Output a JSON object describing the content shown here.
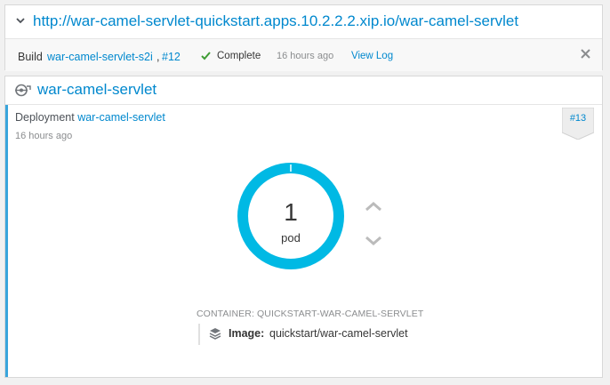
{
  "route": {
    "url": "http://war-camel-servlet-quickstart.apps.10.2.2.2.xip.io/war-camel-servlet"
  },
  "build": {
    "prefix": "Build",
    "config_link": "war-camel-servlet-s2i",
    "separator": ",",
    "number_link": "#12",
    "status": "Complete",
    "time": "16 hours ago",
    "view_log": "View Log"
  },
  "service": {
    "name": "war-camel-servlet"
  },
  "deployment": {
    "label": "Deployment",
    "name_link": "war-camel-servlet",
    "time": "16 hours ago",
    "badge": "#13",
    "pod_count": "1",
    "pod_label": "pod",
    "container_label": "CONTAINER: QUICKSTART-WAR-CAMEL-SERVLET",
    "image_key": "Image:",
    "image_value": "quickstart/war-camel-servlet"
  },
  "colors": {
    "link": "#0088ce",
    "donut": "#00b9e4",
    "accent_bar": "#39a5dc",
    "success": "#3f9c35"
  },
  "icons": {
    "expand": "chevron-down-icon",
    "status": "check-icon",
    "dismiss": "close-icon",
    "service": "service-icon",
    "scale_up": "chevron-up-icon",
    "scale_down": "chevron-down-icon",
    "image": "layers-icon"
  }
}
